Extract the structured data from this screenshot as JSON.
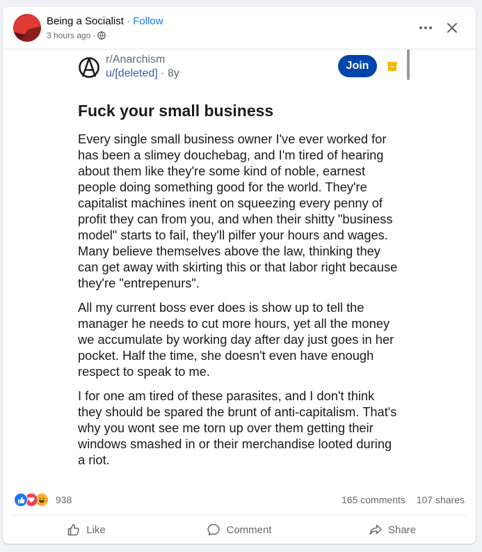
{
  "post": {
    "page_name": "Being a Socialist",
    "separator": "·",
    "follow_label": "Follow",
    "timestamp": "3 hours ago",
    "meta_separator": "·",
    "privacy_icon": "globe-icon",
    "header_icons": [
      "more-options-icon",
      "close-icon"
    ]
  },
  "embed": {
    "subreddit": "r/Anarchism",
    "username": "u/[deleted]",
    "age_separator": "·",
    "age": "8y",
    "join_label": "Join",
    "title": "Fuck your small business",
    "paragraphs": [
      "Every single small business owner I've ever worked for has been a slimey douchebag, and I'm tired of hearing about them like they're some kind of noble, earnest people doing something good for the world. They're capitalist machines inent on squeezing every penny of profit they can from you, and when their shitty \"business model\" starts to fail, they'll pilfer your hours and wages. Many believe themselves above the law, thinking they can get away with skirting this or that labor right because they're \"entrepenurs\".",
      "All my current boss ever does is show up to tell the manager he needs to cut more hours, yet all the money we accumulate by working day after day just goes in her pocket. Half the time, she doesn't even have enough respect to speak to me.",
      "I for one am tired of these parasites, and I don't think they should be spared the brunt of anti-capitalism. That's why you wont see me torn up over them getting their windows smashed in or their merchandise looted during a riot."
    ]
  },
  "engagement": {
    "reaction_types": [
      "like",
      "love",
      "haha"
    ],
    "reaction_count": "938",
    "comments": "165 comments",
    "shares": "107 shares"
  },
  "actions": {
    "like_label": "Like",
    "comment_label": "Comment",
    "share_label": "Share"
  },
  "colors": {
    "facebook_blue": "#1877f2",
    "reddit_join": "#0045ac",
    "text_secondary": "#65676b",
    "love_red": "#f33e58",
    "haha_yellow": "#f7b125"
  }
}
